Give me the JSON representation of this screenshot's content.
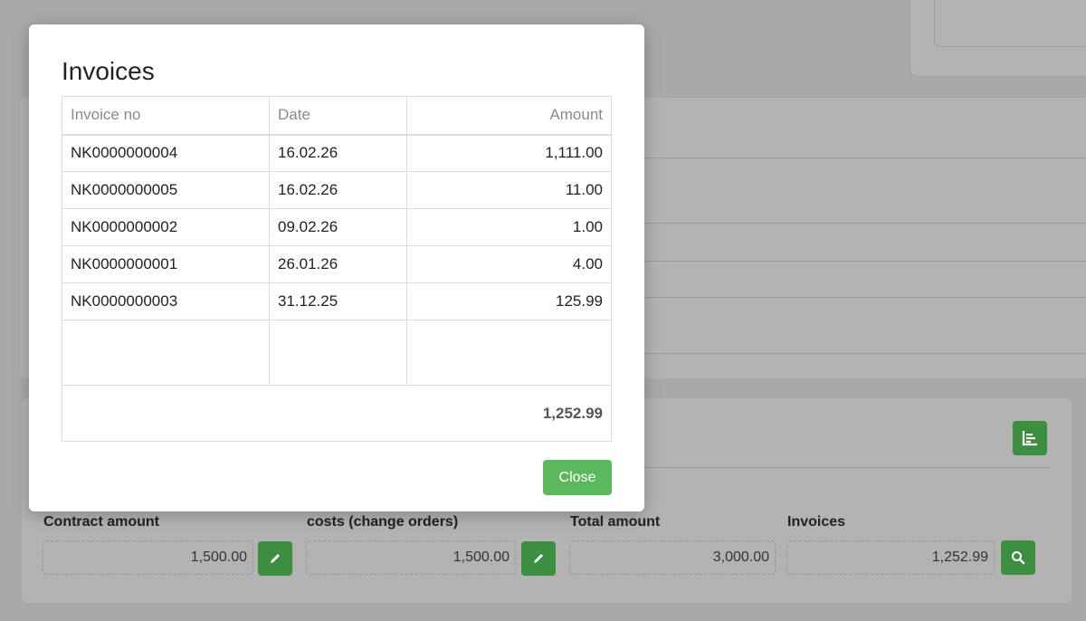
{
  "modal": {
    "title": "Invoices",
    "columns": {
      "invoice_no": "Invoice no",
      "date": "Date",
      "amount": "Amount"
    },
    "rows": [
      {
        "invoice_no": "NK0000000004",
        "date": "16.02.26",
        "amount": "1,111.00"
      },
      {
        "invoice_no": "NK0000000005",
        "date": "16.02.26",
        "amount": "11.00"
      },
      {
        "invoice_no": "NK0000000002",
        "date": "09.02.26",
        "amount": "1.00"
      },
      {
        "invoice_no": "NK0000000001",
        "date": "26.01.26",
        "amount": "4.00"
      },
      {
        "invoice_no": "NK0000000003",
        "date": "31.12.25",
        "amount": "125.99"
      }
    ],
    "total": "1,252.99",
    "close_label": "Close"
  },
  "summary": {
    "contract_amount": {
      "label": "Contract amount",
      "value": "1,500.00",
      "action_icon": "pencil-icon"
    },
    "costs": {
      "label": "costs (change orders)",
      "value": "1,500.00",
      "action_icon": "pencil-icon"
    },
    "total_amount": {
      "label": "Total amount",
      "value": "3,000.00"
    },
    "invoices": {
      "label": "Invoices",
      "value": "1,252.99",
      "action_icon": "search-icon"
    }
  },
  "toolbar": {
    "chart_icon": "chart-icon"
  },
  "colors": {
    "primary_green": "#5cb85c",
    "dark_green": "#3e8e41",
    "overlay_gray": "#a9a9a9"
  }
}
